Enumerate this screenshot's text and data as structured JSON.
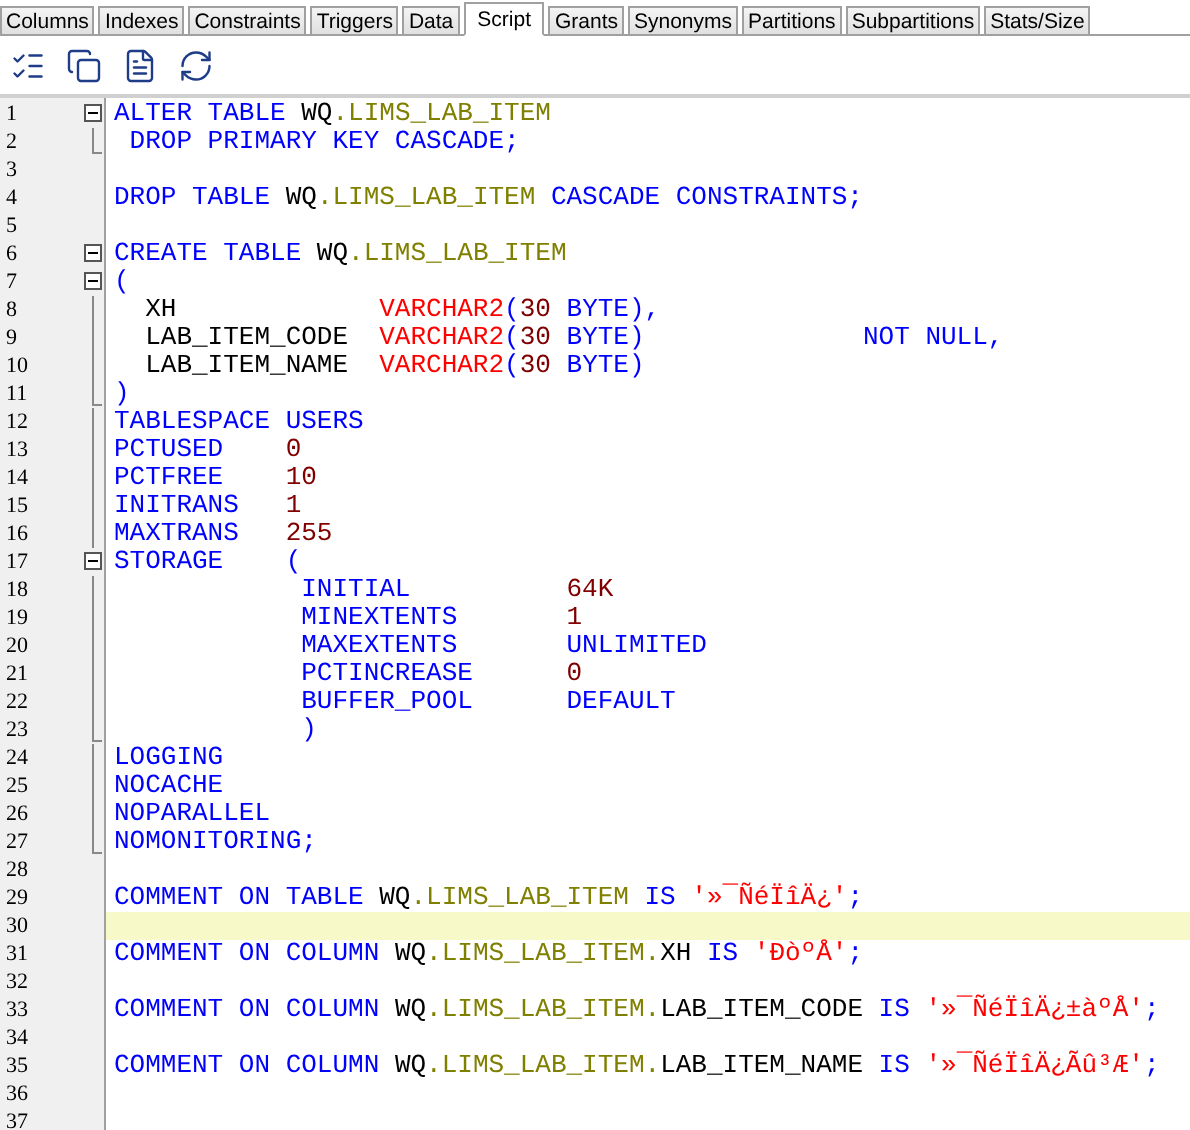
{
  "tabs": [
    {
      "label": "Columns",
      "selected": false
    },
    {
      "label": "Indexes",
      "selected": false
    },
    {
      "label": "Constraints",
      "selected": false
    },
    {
      "label": "Triggers",
      "selected": false
    },
    {
      "label": "Data",
      "selected": false
    },
    {
      "label": "Script",
      "selected": true
    },
    {
      "label": "Grants",
      "selected": false
    },
    {
      "label": "Synonyms",
      "selected": false
    },
    {
      "label": "Partitions",
      "selected": false
    },
    {
      "label": "Subpartitions",
      "selected": false
    },
    {
      "label": "Stats/Size",
      "selected": false
    }
  ],
  "toolbar": [
    {
      "kind": "checklist"
    },
    {
      "kind": "copy"
    },
    {
      "kind": "document"
    },
    {
      "kind": "refresh"
    }
  ],
  "editor": {
    "lines": [
      {
        "number": "1",
        "kind": "foldstart",
        "current": false,
        "tokens": [
          {
            "kind": "kw",
            "text": "ALTER TABLE "
          },
          {
            "kind": "id",
            "text": "WQ"
          },
          {
            "kind": "obj",
            "text": ".LIMS_LAB_ITEM"
          }
        ]
      },
      {
        "number": "2",
        "kind": "foldend",
        "current": false,
        "tokens": [
          {
            "kind": "kw",
            "text": " DROP PRIMARY KEY CASCADE;"
          }
        ]
      },
      {
        "number": "3",
        "kind": "plain",
        "current": false
      },
      {
        "number": "4",
        "kind": "plain",
        "current": false,
        "tokens": [
          {
            "kind": "kw",
            "text": "DROP TABLE "
          },
          {
            "kind": "id",
            "text": "WQ"
          },
          {
            "kind": "obj",
            "text": ".LIMS_LAB_ITEM"
          },
          {
            "kind": "kw",
            "text": " CASCADE CONSTRAINTS;"
          }
        ]
      },
      {
        "number": "5",
        "kind": "plain",
        "current": false
      },
      {
        "number": "6",
        "kind": "foldstart",
        "current": false,
        "tokens": [
          {
            "kind": "kw",
            "text": "CREATE TABLE "
          },
          {
            "kind": "id",
            "text": "WQ"
          },
          {
            "kind": "obj",
            "text": ".LIMS_LAB_ITEM"
          }
        ]
      },
      {
        "number": "7",
        "kind": "foldstart",
        "current": false,
        "tokens": [
          {
            "kind": "kw",
            "text": "("
          }
        ]
      },
      {
        "number": "8",
        "kind": "foldline",
        "current": false,
        "tokens": [
          {
            "kind": "id",
            "text": "  XH             "
          },
          {
            "kind": "type",
            "text": "VARCHAR2"
          },
          {
            "kind": "kw",
            "text": "("
          },
          {
            "kind": "num",
            "text": "30"
          },
          {
            "kind": "kw",
            "text": " BYTE),"
          }
        ]
      },
      {
        "number": "9",
        "kind": "foldline",
        "current": false,
        "tokens": [
          {
            "kind": "id",
            "text": "  LAB_ITEM_CODE  "
          },
          {
            "kind": "type",
            "text": "VARCHAR2"
          },
          {
            "kind": "kw",
            "text": "("
          },
          {
            "kind": "num",
            "text": "30"
          },
          {
            "kind": "kw",
            "text": " BYTE)              NOT NULL,"
          }
        ]
      },
      {
        "number": "10",
        "kind": "foldline",
        "current": false,
        "tokens": [
          {
            "kind": "id",
            "text": "  LAB_ITEM_NAME  "
          },
          {
            "kind": "type",
            "text": "VARCHAR2"
          },
          {
            "kind": "kw",
            "text": "("
          },
          {
            "kind": "num",
            "text": "30"
          },
          {
            "kind": "kw",
            "text": " BYTE)"
          }
        ]
      },
      {
        "number": "11",
        "kind": "foldend",
        "current": false,
        "tokens": [
          {
            "kind": "kw",
            "text": ")"
          }
        ]
      },
      {
        "number": "12",
        "kind": "foldline",
        "current": false,
        "tokens": [
          {
            "kind": "kw",
            "text": "TABLESPACE USERS"
          }
        ]
      },
      {
        "number": "13",
        "kind": "foldline",
        "current": false,
        "tokens": [
          {
            "kind": "kw",
            "text": "PCTUSED    "
          },
          {
            "kind": "num",
            "text": "0"
          }
        ]
      },
      {
        "number": "14",
        "kind": "foldline",
        "current": false,
        "tokens": [
          {
            "kind": "kw",
            "text": "PCTFREE    "
          },
          {
            "kind": "num",
            "text": "10"
          }
        ]
      },
      {
        "number": "15",
        "kind": "foldline",
        "current": false,
        "tokens": [
          {
            "kind": "kw",
            "text": "INITRANS   "
          },
          {
            "kind": "num",
            "text": "1"
          }
        ]
      },
      {
        "number": "16",
        "kind": "foldline",
        "current": false,
        "tokens": [
          {
            "kind": "kw",
            "text": "MAXTRANS   "
          },
          {
            "kind": "num",
            "text": "255"
          }
        ]
      },
      {
        "number": "17",
        "kind": "foldstart",
        "current": false,
        "tokens": [
          {
            "kind": "kw",
            "text": "STORAGE    ("
          }
        ]
      },
      {
        "number": "18",
        "kind": "foldline",
        "current": false,
        "tokens": [
          {
            "kind": "kw",
            "text": "            INITIAL          "
          },
          {
            "kind": "num",
            "text": "64K"
          }
        ]
      },
      {
        "number": "19",
        "kind": "foldline",
        "current": false,
        "tokens": [
          {
            "kind": "kw",
            "text": "            MINEXTENTS       "
          },
          {
            "kind": "num",
            "text": "1"
          }
        ]
      },
      {
        "number": "20",
        "kind": "foldline",
        "current": false,
        "tokens": [
          {
            "kind": "kw",
            "text": "            MAXEXTENTS       UNLIMITED"
          }
        ]
      },
      {
        "number": "21",
        "kind": "foldline",
        "current": false,
        "tokens": [
          {
            "kind": "kw",
            "text": "            PCTINCREASE      "
          },
          {
            "kind": "num",
            "text": "0"
          }
        ]
      },
      {
        "number": "22",
        "kind": "foldline",
        "current": false,
        "tokens": [
          {
            "kind": "kw",
            "text": "            BUFFER_POOL      DEFAULT"
          }
        ]
      },
      {
        "number": "23",
        "kind": "foldend",
        "current": false,
        "tokens": [
          {
            "kind": "kw",
            "text": "            )"
          }
        ]
      },
      {
        "number": "24",
        "kind": "foldline",
        "current": false,
        "tokens": [
          {
            "kind": "kw",
            "text": "LOGGING"
          }
        ]
      },
      {
        "number": "25",
        "kind": "foldline",
        "current": false,
        "tokens": [
          {
            "kind": "kw",
            "text": "NOCACHE"
          }
        ]
      },
      {
        "number": "26",
        "kind": "foldline",
        "current": false,
        "tokens": [
          {
            "kind": "kw",
            "text": "NOPARALLEL"
          }
        ]
      },
      {
        "number": "27",
        "kind": "foldend",
        "current": false,
        "tokens": [
          {
            "kind": "kw",
            "text": "NOMONITORING;"
          }
        ]
      },
      {
        "number": "28",
        "kind": "plain",
        "current": false
      },
      {
        "number": "29",
        "kind": "plain",
        "current": false,
        "tokens": [
          {
            "kind": "kw",
            "text": "COMMENT ON TABLE "
          },
          {
            "kind": "id",
            "text": "WQ"
          },
          {
            "kind": "obj",
            "text": ".LIMS_LAB_ITEM"
          },
          {
            "kind": "kw",
            "text": " IS "
          },
          {
            "kind": "str",
            "text": "'»¯ÑéÏîÄ¿'"
          },
          {
            "kind": "kw",
            "text": ";"
          }
        ]
      },
      {
        "number": "30",
        "kind": "plain",
        "current": true
      },
      {
        "number": "31",
        "kind": "plain",
        "current": false,
        "tokens": [
          {
            "kind": "kw",
            "text": "COMMENT ON COLUMN "
          },
          {
            "kind": "id",
            "text": "WQ"
          },
          {
            "kind": "obj",
            "text": ".LIMS_LAB_ITEM."
          },
          {
            "kind": "id",
            "text": "XH"
          },
          {
            "kind": "kw",
            "text": " IS "
          },
          {
            "kind": "str",
            "text": "'ÐòºÅ'"
          },
          {
            "kind": "kw",
            "text": ";"
          }
        ]
      },
      {
        "number": "32",
        "kind": "plain",
        "current": false
      },
      {
        "number": "33",
        "kind": "plain",
        "current": false,
        "tokens": [
          {
            "kind": "kw",
            "text": "COMMENT ON COLUMN "
          },
          {
            "kind": "id",
            "text": "WQ"
          },
          {
            "kind": "obj",
            "text": ".LIMS_LAB_ITEM."
          },
          {
            "kind": "id",
            "text": "LAB_ITEM_CODE"
          },
          {
            "kind": "kw",
            "text": " IS "
          },
          {
            "kind": "str",
            "text": "'»¯ÑéÏîÄ¿±àºÅ'"
          },
          {
            "kind": "kw",
            "text": ";"
          }
        ]
      },
      {
        "number": "34",
        "kind": "plain",
        "current": false
      },
      {
        "number": "35",
        "kind": "plain",
        "current": false,
        "tokens": [
          {
            "kind": "kw",
            "text": "COMMENT ON COLUMN "
          },
          {
            "kind": "id",
            "text": "WQ"
          },
          {
            "kind": "obj",
            "text": ".LIMS_LAB_ITEM."
          },
          {
            "kind": "id",
            "text": "LAB_ITEM_NAME"
          },
          {
            "kind": "kw",
            "text": " IS "
          },
          {
            "kind": "str",
            "text": "'»¯ÑéÏîÄ¿Ãû³Æ'"
          },
          {
            "kind": "kw",
            "text": ";"
          }
        ]
      },
      {
        "number": "36",
        "kind": "plain",
        "current": false
      },
      {
        "number": "37",
        "kind": "plain",
        "current": false
      }
    ]
  }
}
